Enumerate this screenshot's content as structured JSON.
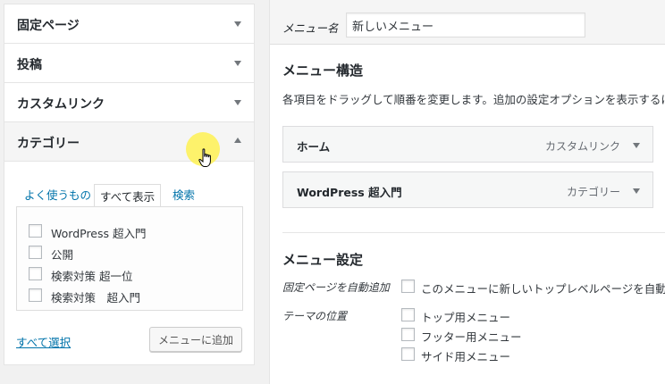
{
  "sidebar": {
    "panels": [
      {
        "label": "固定ページ"
      },
      {
        "label": "投稿"
      },
      {
        "label": "カスタムリンク"
      },
      {
        "label": "カテゴリー"
      }
    ],
    "tabs": [
      "よく使うもの",
      "すべて表示",
      "検索"
    ],
    "categories": [
      "WordPress 超入門",
      "公開",
      "検索対策 超一位",
      "検索対策　超入門"
    ],
    "select_all": "すべて選択",
    "add_button": "メニューに追加"
  },
  "menu": {
    "name_label": "メニュー名",
    "name_value": "新しいメニュー",
    "structure_title": "メニュー構造",
    "structure_desc": "各項目をドラッグして順番を変更します。追加の設定オプションを表示するには、",
    "items": [
      {
        "title": "ホーム",
        "type": "カスタムリンク"
      },
      {
        "title": "WordPress 超入門",
        "type": "カテゴリー"
      }
    ],
    "settings_title": "メニュー設定",
    "auto_add_label": "固定ページを自動追加",
    "auto_add_text": "このメニューに新しいトップレベルページを自動的に",
    "theme_location_label": "テーマの位置",
    "locations": [
      "トップ用メニュー",
      "フッター用メニュー",
      "サイド用メニュー"
    ]
  }
}
